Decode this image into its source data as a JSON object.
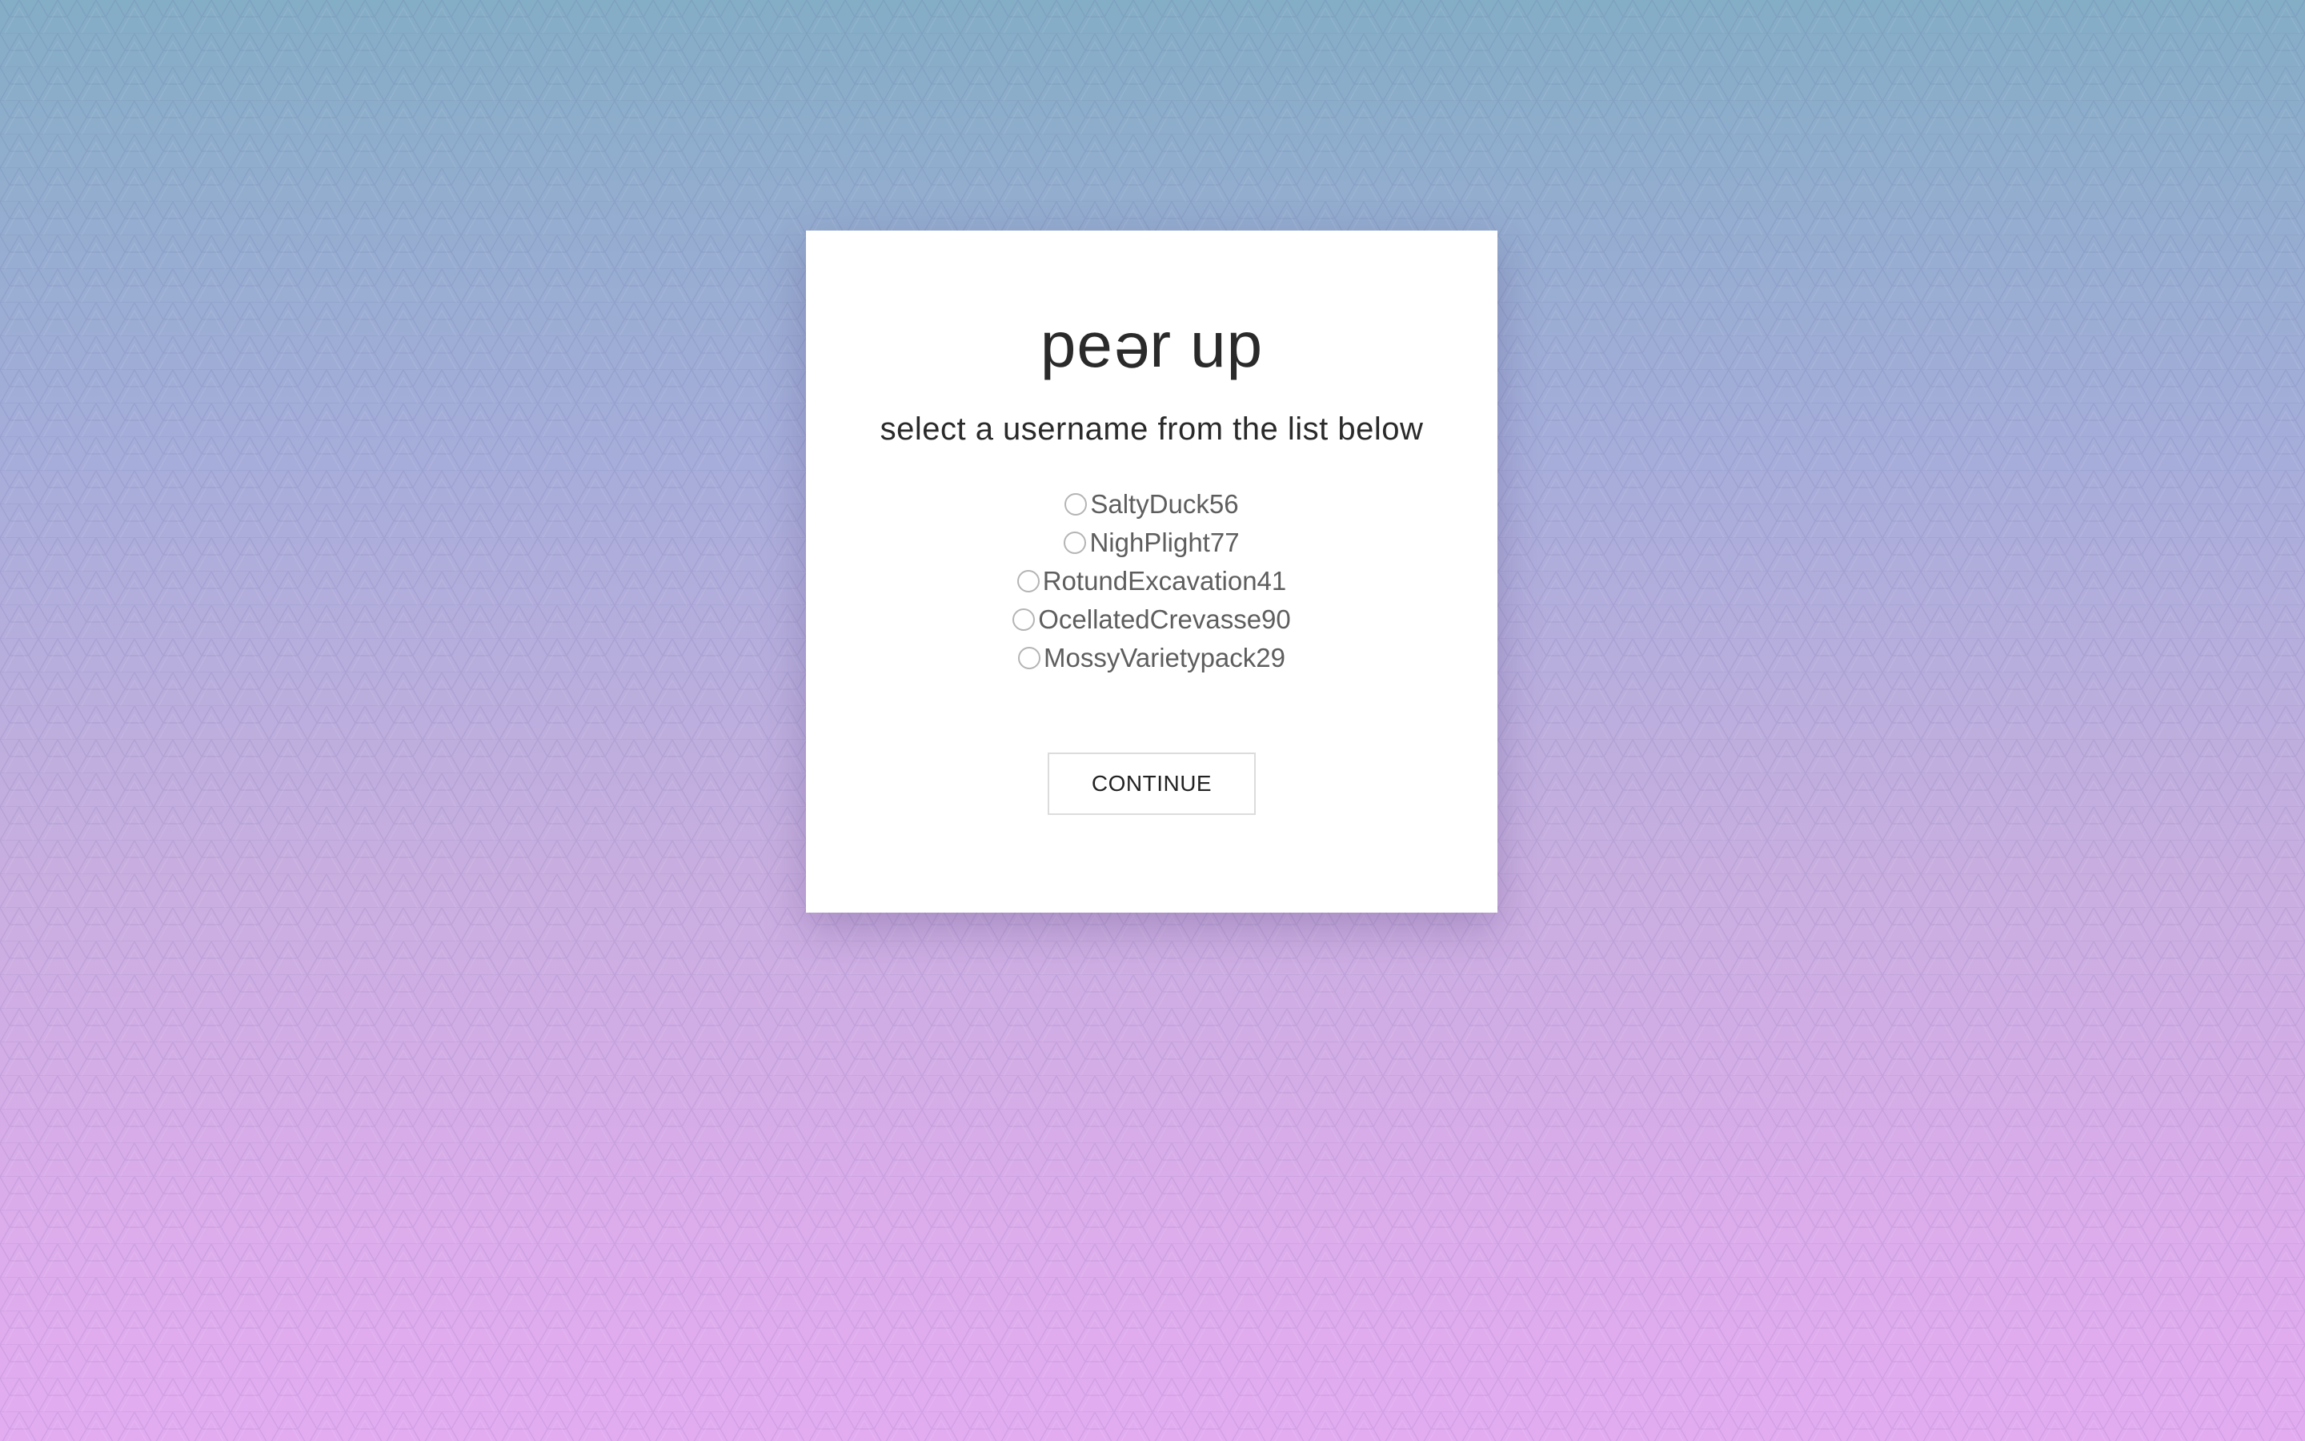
{
  "app": {
    "title_before": "pe",
    "title_flipped_letter": "e",
    "title_after": "r up"
  },
  "prompt": "select a username from the list below",
  "usernames": [
    {
      "label": "SaltyDuck56",
      "selected": false
    },
    {
      "label": "NighPlight77",
      "selected": false
    },
    {
      "label": "RotundExcavation41",
      "selected": false
    },
    {
      "label": "OcellatedCrevasse90",
      "selected": false
    },
    {
      "label": "MossyVarietypack29",
      "selected": false
    }
  ],
  "continue_label": "CONTINUE",
  "colors": {
    "background_top": "#84adc6",
    "background_bottom": "#e3acf1",
    "card": "#ffffff",
    "text": "#2a2a2a",
    "radio_border": "#b4b4b4"
  }
}
